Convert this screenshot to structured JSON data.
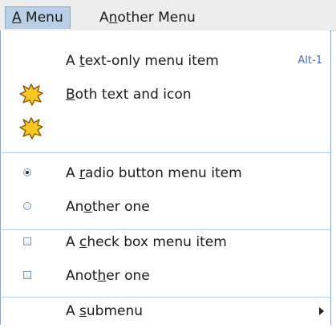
{
  "menubar": {
    "menus": [
      {
        "label": "A Menu",
        "mnemonic": "A"
      },
      {
        "label": "Another Menu",
        "mnemonic": "n"
      }
    ]
  },
  "popup": {
    "items": [
      {
        "type": "text",
        "label": "A text-only menu item",
        "mnemonic": "t",
        "accelerator": "Alt-1"
      },
      {
        "type": "icon-text",
        "label": "Both text and icon",
        "mnemonic": "B",
        "icon": "starburst-icon"
      },
      {
        "type": "icon-only",
        "icon": "starburst-icon"
      },
      {
        "type": "radio",
        "label": "A radio button menu item",
        "mnemonic": "r",
        "selected": true
      },
      {
        "type": "radio",
        "label": "Another one",
        "mnemonic": "o",
        "selected": false
      },
      {
        "type": "checkbox",
        "label": "A check box menu item",
        "mnemonic": "c",
        "checked": false
      },
      {
        "type": "checkbox",
        "label": "Another one",
        "mnemonic": "h",
        "checked": false
      },
      {
        "type": "submenu",
        "label": "A submenu",
        "mnemonic": "s"
      }
    ]
  },
  "colors": {
    "menubar_bg": "#ededed",
    "selected_menu_bg": "#b8cfe5",
    "accelerator_text": "#4a6ea9",
    "icon_fill": "#f7c620",
    "icon_outline": "#8a5a00"
  }
}
